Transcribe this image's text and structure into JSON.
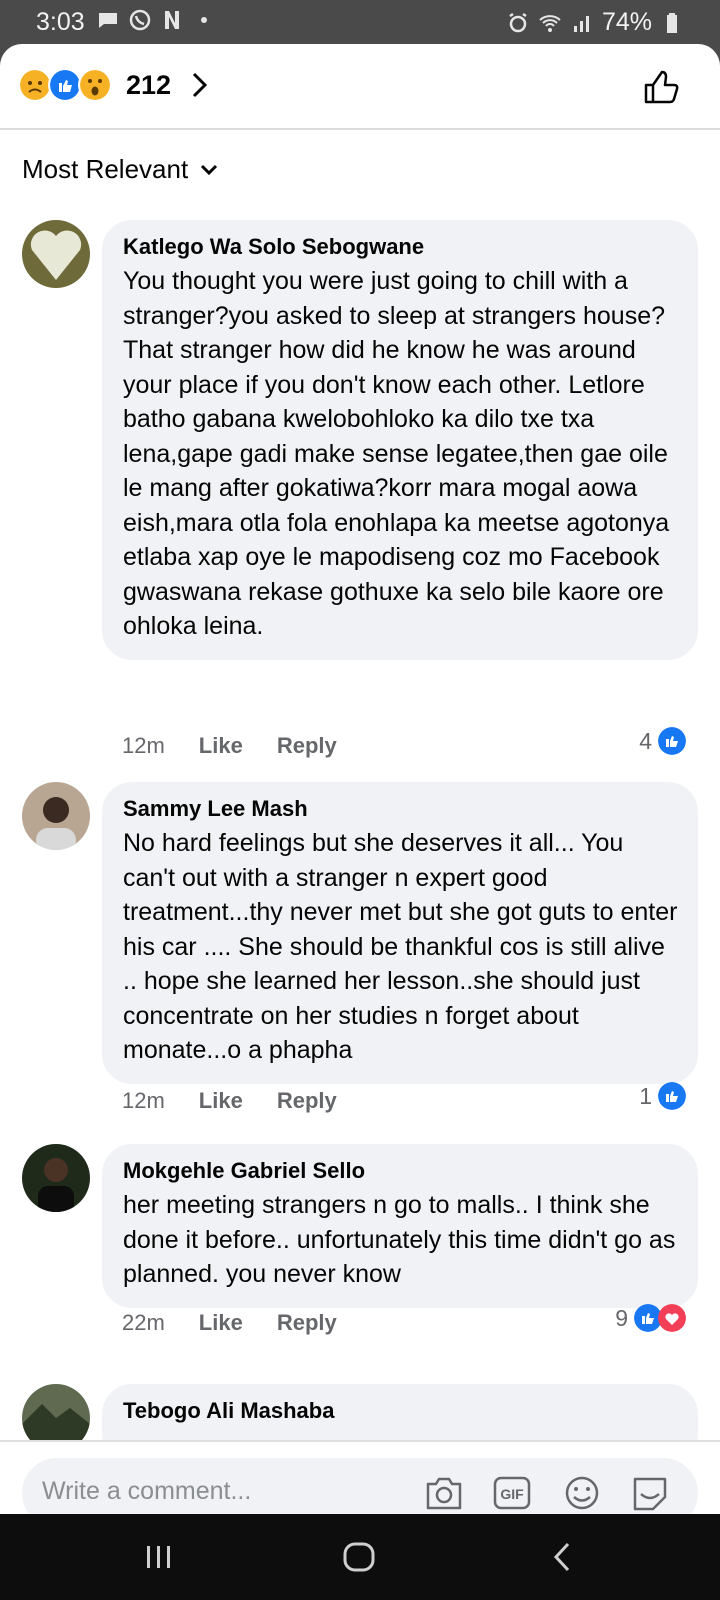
{
  "status_bar": {
    "time": "3:03",
    "battery": "74%"
  },
  "reactions": {
    "count": "212",
    "icons": [
      "sad-reaction-icon",
      "like-reaction-icon",
      "wow-reaction-icon"
    ]
  },
  "sort": {
    "label": "Most Relevant"
  },
  "comments": [
    {
      "author": "Katlego Wa Solo Sebogwane",
      "text": "You thought you were just going to chill with a stranger?you asked to sleep at strangers house?\nThat stranger how did he know he was around your place if you don't know each other. Letlore batho gabana kwelobohloko ka dilo txe txa lena,gape gadi make sense legatee,then gae oile le mang after gokatiwa?korr mara mogal aowa eish,mara otla fola enohlapa ka meetse agotonya etlaba xap oye le mapodiseng coz mo Facebook gwaswana rekase gothuxe ka selo bile kaore ore ohloka leina.",
      "time": "12m",
      "like_label": "Like",
      "reply_label": "Reply",
      "reaction_count": "4"
    },
    {
      "author": "Sammy Lee Mash",
      "text": "No hard feelings but she deserves it all... You can't out with a stranger n expert good treatment...thy never met but she got guts to enter his car .... She should be thankful cos is still alive .. hope she learned her lesson..she should just concentrate on her studies n forget about monate...o a phapha",
      "time": "12m",
      "like_label": "Like",
      "reply_label": "Reply",
      "reaction_count": "1"
    },
    {
      "author": "Mokgehle Gabriel Sello",
      "text": "her meeting strangers n go to malls.. I think she done it before.. unfortunately this time didn't go as planned. you never know",
      "time": "22m",
      "like_label": "Like",
      "reply_label": "Reply",
      "reaction_count": "9"
    },
    {
      "author": "Tebogo Ali Mashaba"
    }
  ],
  "composer": {
    "placeholder": "Write a comment..."
  },
  "colors": {
    "like_blue": "#1877f2",
    "love_red": "#f33e58",
    "bubble_gray": "#f0f2f5"
  }
}
